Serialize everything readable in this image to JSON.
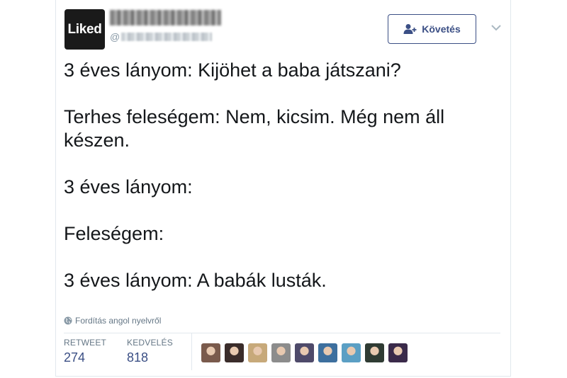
{
  "tweet": {
    "avatar_text": "Liked",
    "handle_prefix": "@",
    "follow_label": "Követés",
    "lines": [
      "3 éves lányom: Kijöhet a baba játszani?",
      "",
      "Terhes feleségem: Nem, kicsim. Még nem áll",
      "készen.",
      "",
      "3 éves lányom:",
      "",
      "Feleségem:",
      "",
      "3 éves lányom: A babák lusták."
    ],
    "translate_label": "Fordítás angol nyelvről"
  },
  "stats": {
    "retweet_label": "RETWEET",
    "retweet_count": "274",
    "likes_label": "KEDVELÉS",
    "likes_count": "818"
  },
  "colors": {
    "accent": "#3b4f85",
    "muted": "#657786",
    "border": "#e1e8ed"
  },
  "liker_avatars": [
    "#7a5a4c",
    "#3a2c2a",
    "#c7a97a",
    "#8c8c8c",
    "#4e4a6a",
    "#3d6f9e",
    "#5b9fc4",
    "#2f3b33",
    "#3a2a4a"
  ]
}
